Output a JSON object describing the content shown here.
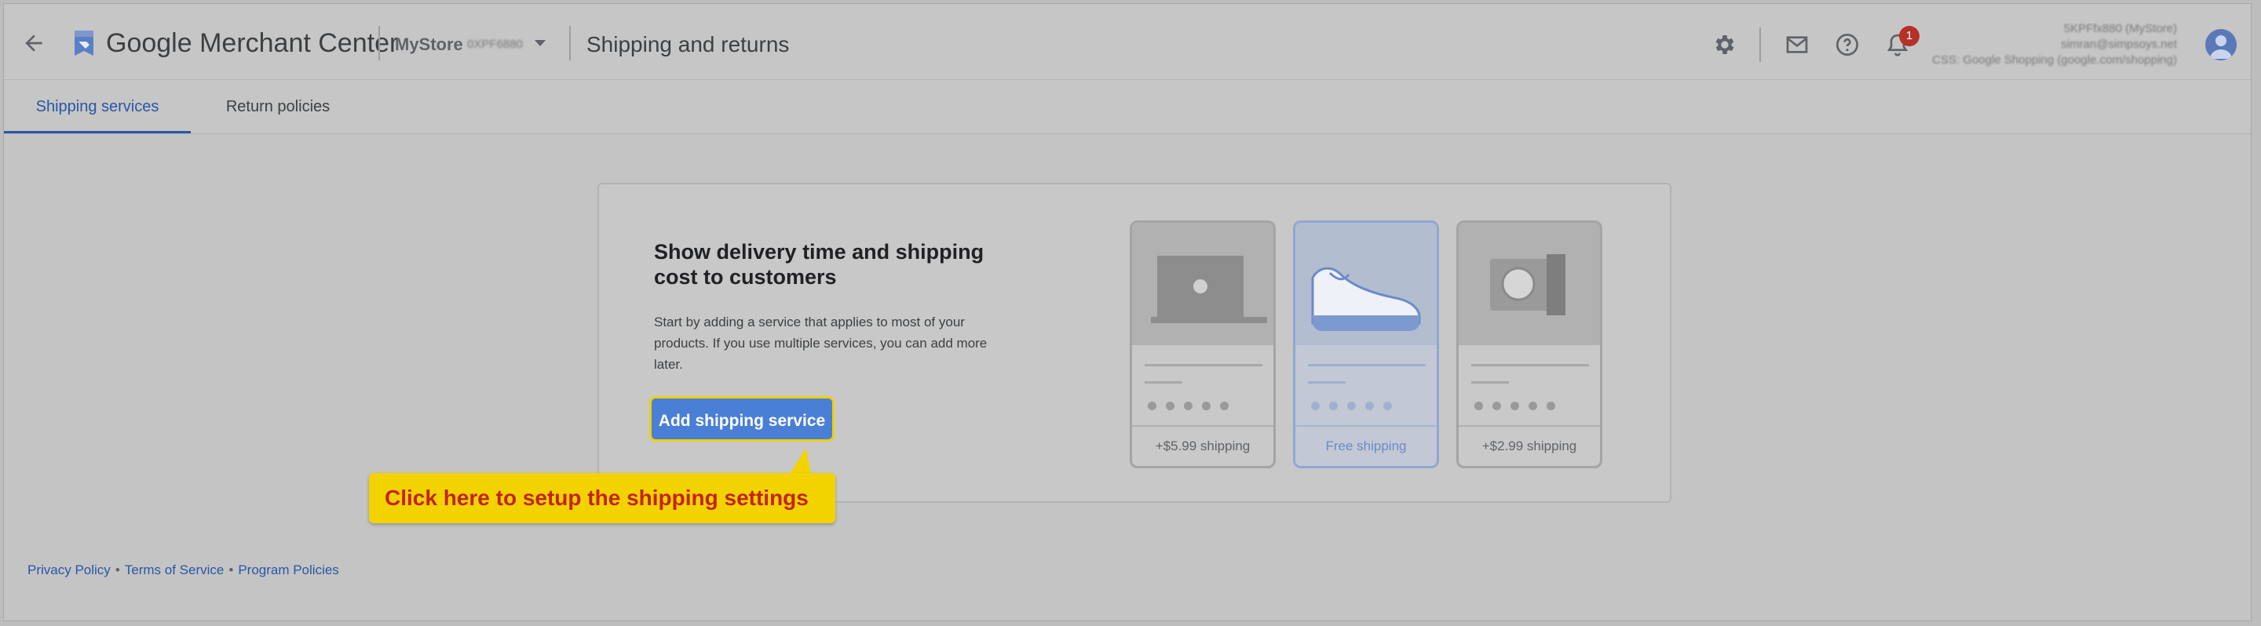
{
  "header": {
    "brand": "Google Merchant Center",
    "store_name": "MyStore",
    "store_id": "0XPF6880",
    "page_title": "Shipping and returns",
    "notification_count": "1",
    "account_lines": [
      "5KPFfx880 (MyStore)",
      "simran@simpsoys.net",
      "CSS: Google Shopping (google.com/shopping)"
    ]
  },
  "tabs": [
    {
      "label": "Shipping services",
      "active": true
    },
    {
      "label": "Return policies",
      "active": false
    }
  ],
  "card": {
    "title": "Show delivery time and shipping cost to customers",
    "description": "Start by adding a service that applies to most of your products. If you use multiple services, you can add more later.",
    "button_label": "Add shipping service",
    "products": [
      {
        "icon": "laptop-icon",
        "shipping": "+$5.99 shipping",
        "selected": false
      },
      {
        "icon": "shoe-icon",
        "shipping": "Free shipping",
        "selected": true
      },
      {
        "icon": "camera-icon",
        "shipping": "+$2.99 shipping",
        "selected": false
      }
    ]
  },
  "callout": {
    "text": "Click here to setup the shipping settings"
  },
  "footer": {
    "links": [
      "Privacy Policy",
      "Terms of Service",
      "Program Policies"
    ],
    "separator": "•"
  },
  "colors": {
    "accent": "#2a56a6",
    "button": "#4a7fd6",
    "callout_bg": "#f2d300",
    "callout_text": "#c4231c",
    "badge": "#b43228"
  }
}
